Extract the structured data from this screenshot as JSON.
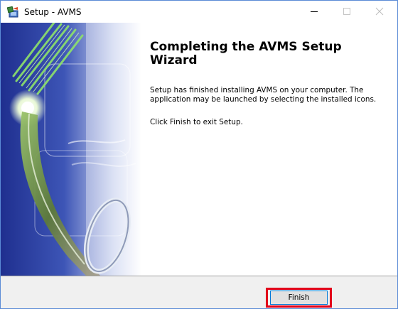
{
  "window": {
    "title": "Setup - AVMS",
    "app_icon": "setup-installer-icon",
    "controls": {
      "minimize_icon": "minimize-icon",
      "maximize_icon": "maximize-icon",
      "close_icon": "close-icon"
    }
  },
  "page": {
    "heading": "Completing the AVMS Setup Wizard",
    "message": "Setup has finished installing AVMS on your computer. The application may be launched by selecting the installed icons.",
    "instruction": "Click Finish to exit Setup."
  },
  "footer": {
    "finish_label": "Finish"
  },
  "colors": {
    "window_border": "#5b8bd6",
    "footer_background": "#f0f0f0",
    "button_focus_border": "#0078d7",
    "highlight_box": "#e2001a",
    "image_blue": "#2a3e9e"
  }
}
